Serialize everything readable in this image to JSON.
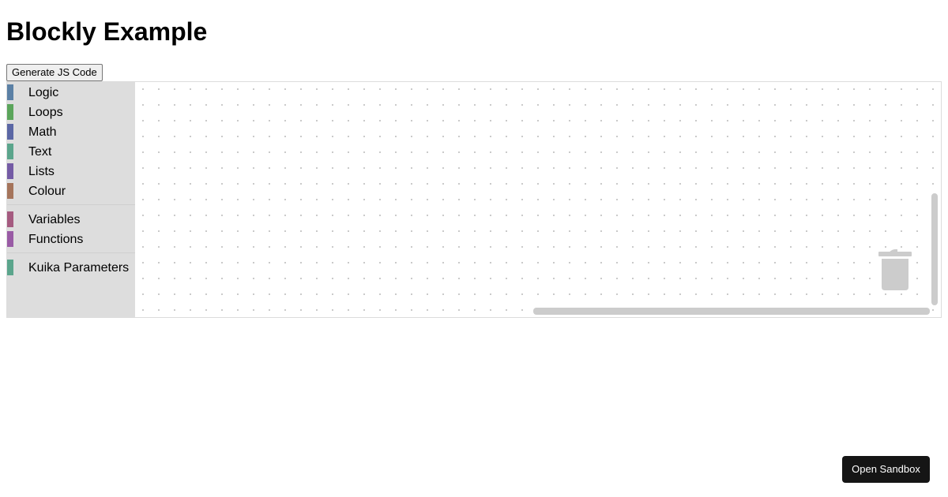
{
  "page": {
    "title": "Blockly Example"
  },
  "toolbar": {
    "generate_label": "Generate JS Code"
  },
  "toolbox": {
    "groups": [
      {
        "items": [
          {
            "label": "Logic",
            "color": "#5b80a5"
          },
          {
            "label": "Loops",
            "color": "#5ba55b"
          },
          {
            "label": "Math",
            "color": "#5b67a5"
          },
          {
            "label": "Text",
            "color": "#5ba58c"
          },
          {
            "label": "Lists",
            "color": "#745ba5"
          },
          {
            "label": "Colour",
            "color": "#a5745b"
          }
        ]
      },
      {
        "items": [
          {
            "label": "Variables",
            "color": "#a55b80"
          },
          {
            "label": "Functions",
            "color": "#995ba5"
          }
        ]
      },
      {
        "items": [
          {
            "label": "Kuika Parameters",
            "color": "#5ba58c"
          }
        ]
      }
    ]
  },
  "workspace": {
    "trash_icon": "trash-can-icon",
    "grid_color": "#c6c6c6",
    "toolbox_bg": "#dddddd"
  },
  "footer": {
    "sandbox_label": "Open Sandbox"
  }
}
